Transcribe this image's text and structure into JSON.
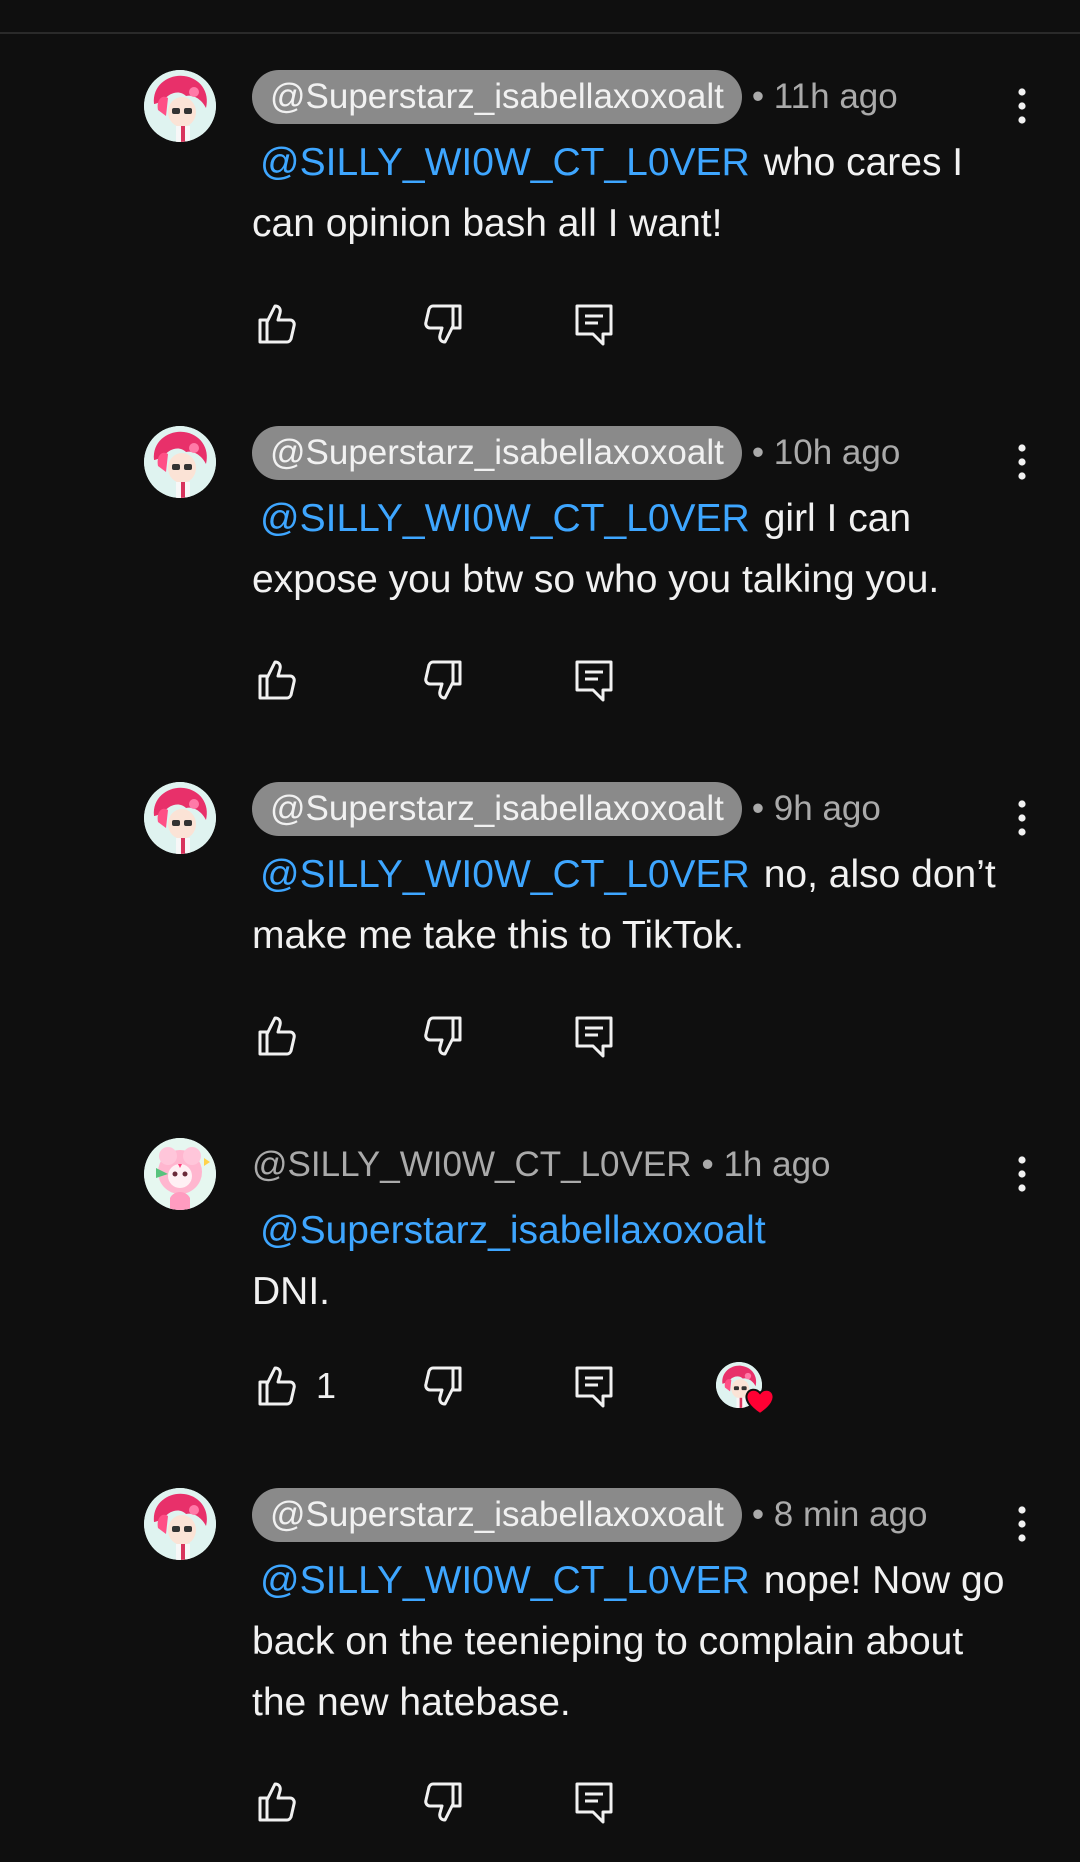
{
  "icons": {
    "like": "thumbs-up-icon",
    "dislike": "thumbs-down-icon",
    "reply": "reply-comment-icon",
    "menu": "more-vert-icon",
    "heart": "creator-heart-icon"
  },
  "colors": {
    "background": "#0f0f0f",
    "mention": "#3ea6ff",
    "pill": "#8a8a8a",
    "meta": "#aaaaaa",
    "heart": "#ff0033"
  },
  "comments": [
    {
      "handle": "@Superstarz_isabellaxoxoalt",
      "time": "• 11h ago",
      "mention": "@SILLY_WI0W_CT_L0VER",
      "text": "who cares I can opinion bash all I want!"
    },
    {
      "handle": "@Superstarz_isabellaxoxoalt",
      "time": "• 10h ago",
      "mention": "@SILLY_WI0W_CT_L0VER",
      "text": "girl I can expose you btw so who you talking you."
    },
    {
      "handle": "@Superstarz_isabellaxoxoalt",
      "time": "• 9h ago",
      "mention": "@SILLY_WI0W_CT_L0VER",
      "text": "no, also don’t make me take this to TikTok."
    },
    {
      "handle": "@SILLY_WI0W_CT_L0VER",
      "time": "• 1h ago",
      "mention": "@Superstarz_isabellaxoxoalt",
      "text": "DNI.",
      "likes": "1"
    },
    {
      "handle": "@Superstarz_isabellaxoxoalt",
      "time": "• 8 min ago",
      "mention": "@SILLY_WI0W_CT_L0VER",
      "text": "nope! Now go back on the teenieping to complain about the new hatebase."
    }
  ]
}
